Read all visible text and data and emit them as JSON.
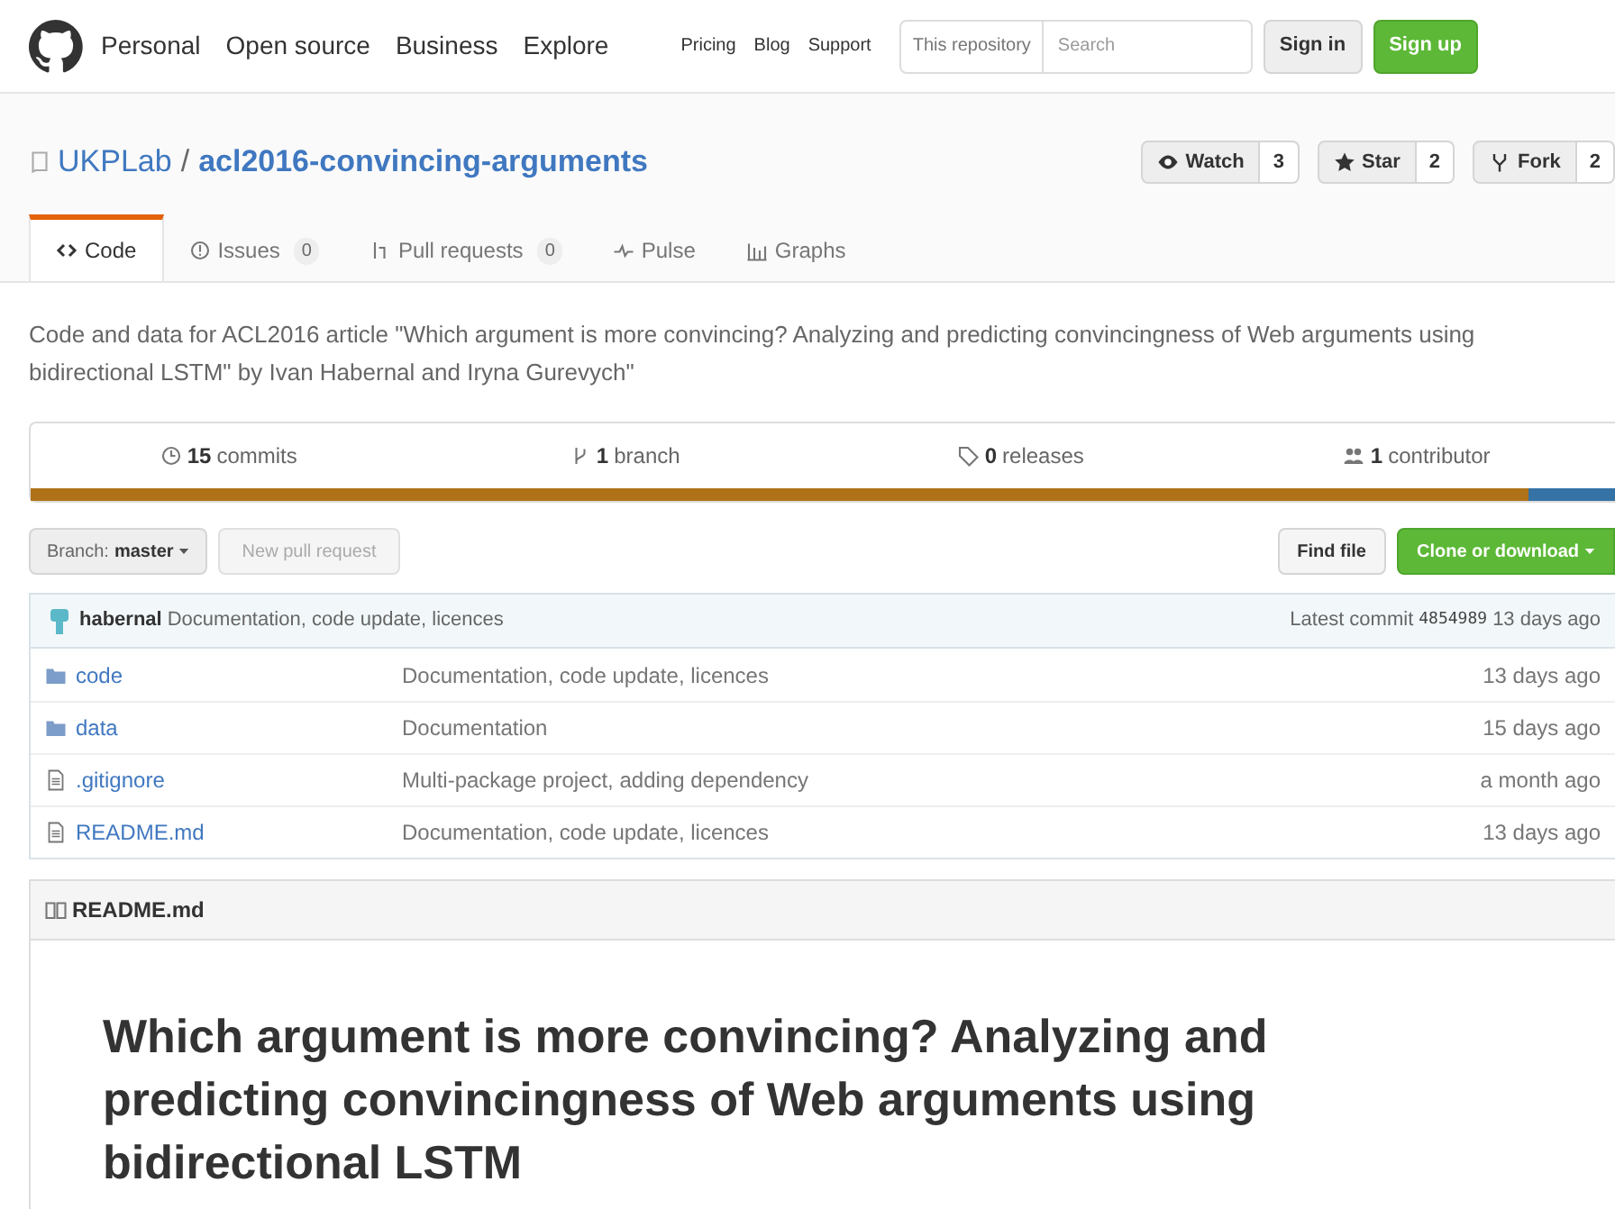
{
  "header": {
    "nav": [
      "Personal",
      "Open source",
      "Business",
      "Explore"
    ],
    "links": [
      "Pricing",
      "Blog",
      "Support"
    ],
    "search": {
      "scope": "This repository",
      "placeholder": "Search"
    },
    "sign_in": "Sign in",
    "sign_up": "Sign up"
  },
  "repo": {
    "owner": "UKPLab",
    "separator": "/",
    "name": "acl2016-convincing-arguments",
    "actions": [
      {
        "label": "Watch",
        "count": "3",
        "kind": "eye"
      },
      {
        "label": "Star",
        "count": "2",
        "kind": "star"
      },
      {
        "label": "Fork",
        "count": "2",
        "kind": "fork"
      }
    ]
  },
  "tabs": [
    {
      "label": "Code",
      "kind": "code",
      "selected": true
    },
    {
      "label": "Issues",
      "count": "0",
      "kind": "issue",
      "selected": false
    },
    {
      "label": "Pull requests",
      "count": "0",
      "kind": "pr",
      "selected": false
    },
    {
      "label": "Pulse",
      "kind": "pulse",
      "selected": false
    },
    {
      "label": "Graphs",
      "kind": "graph",
      "selected": false
    }
  ],
  "description": "Code and data for ACL2016 article \"Which argument is more convincing? Analyzing and predicting convincingness of Web arguments using bidirectional LSTM\" by Ivan Habernal and Iryna Gurevych\"",
  "summary": [
    {
      "number": "15",
      "label": "commits",
      "kind": "history"
    },
    {
      "number": "1",
      "label": "branch",
      "kind": "branch"
    },
    {
      "number": "0",
      "label": "releases",
      "kind": "tag"
    },
    {
      "number": "1",
      "label": "contributor",
      "kind": "people"
    }
  ],
  "languages": [
    {
      "color": "#b07219",
      "level": 0.945
    },
    {
      "color": "#3572a5",
      "level": 0.055
    }
  ],
  "branch": {
    "label": "Branch:",
    "value": "master"
  },
  "new_pull_request": "New pull request",
  "find_file": "Find file",
  "clone": "Clone or download",
  "commit": {
    "author": "habernal",
    "message": "Documentation, code update, licences",
    "latest": "Latest commit",
    "sha": "4854989",
    "age": "13 days ago"
  },
  "files": [
    {
      "name": "code",
      "kind": "folder",
      "message": "Documentation, code update, licences",
      "age": "13 days ago"
    },
    {
      "name": "data",
      "kind": "folder",
      "message": "Documentation",
      "age": "15 days ago"
    },
    {
      "name": ".gitignore",
      "kind": "file",
      "message": "Multi-package project, adding dependency",
      "age": "a month ago"
    },
    {
      "name": "README.md",
      "kind": "file",
      "message": "Documentation, code update, licences",
      "age": "13 days ago"
    }
  ],
  "readme": {
    "title": "README.md",
    "heading": "Which argument is more convincing? Analyzing and predicting convincingness of Web arguments using bidirectional LSTM"
  }
}
